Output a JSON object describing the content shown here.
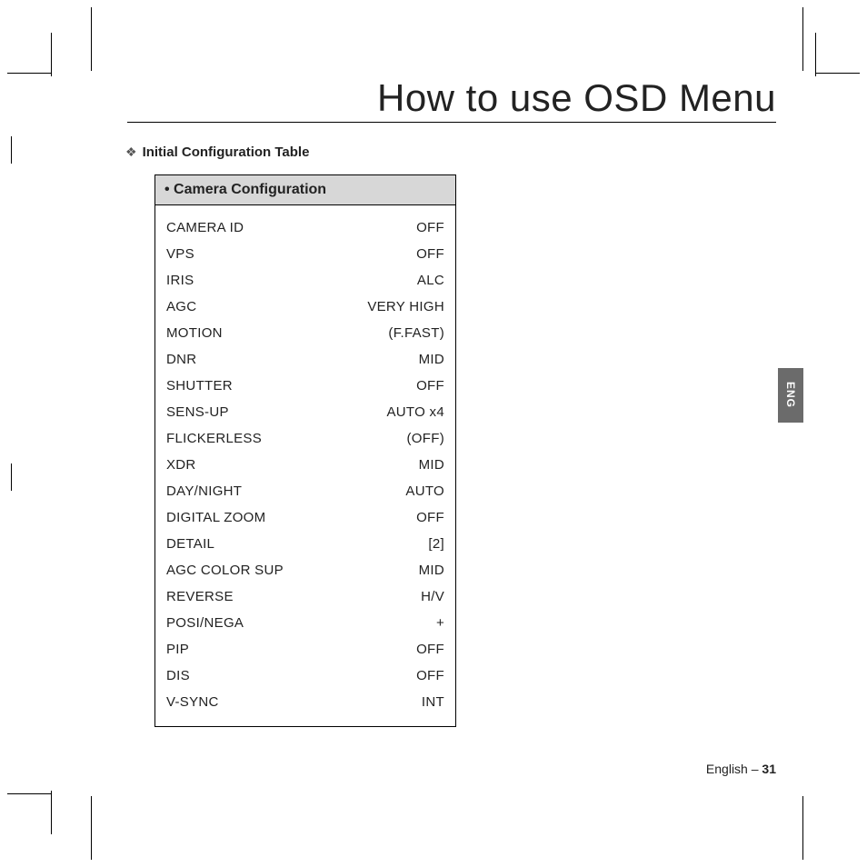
{
  "title": "How to use OSD Menu",
  "subtitle": "Initial Configuration Table",
  "table_header": "• Camera Configuration",
  "rows": [
    {
      "label": "CAMERA ID",
      "value": "OFF"
    },
    {
      "label": "VPS",
      "value": "OFF"
    },
    {
      "label": "IRIS",
      "value": "ALC"
    },
    {
      "label": "AGC",
      "value": "VERY HIGH"
    },
    {
      "label": "MOTION",
      "value": "(F.FAST)"
    },
    {
      "label": "DNR",
      "value": "MID"
    },
    {
      "label": "SHUTTER",
      "value": "OFF"
    },
    {
      "label": "SENS-UP",
      "value": "AUTO x4"
    },
    {
      "label": "FLICKERLESS",
      "value": "(OFF)"
    },
    {
      "label": "XDR",
      "value": "MID"
    },
    {
      "label": "DAY/NIGHT",
      "value": "AUTO"
    },
    {
      "label": "DIGITAL ZOOM",
      "value": "OFF"
    },
    {
      "label": "DETAIL",
      "value": "[2]"
    },
    {
      "label": "AGC COLOR SUP",
      "value": "MID"
    },
    {
      "label": "REVERSE",
      "value": "H/V"
    },
    {
      "label": "POSI/NEGA",
      "value": "+"
    },
    {
      "label": "PIP",
      "value": "OFF"
    },
    {
      "label": "DIS",
      "value": "OFF"
    },
    {
      "label": "V-SYNC",
      "value": "INT"
    }
  ],
  "lang_tab": "ENG",
  "footer_lang": "English",
  "footer_sep": " – ",
  "footer_page": "31"
}
